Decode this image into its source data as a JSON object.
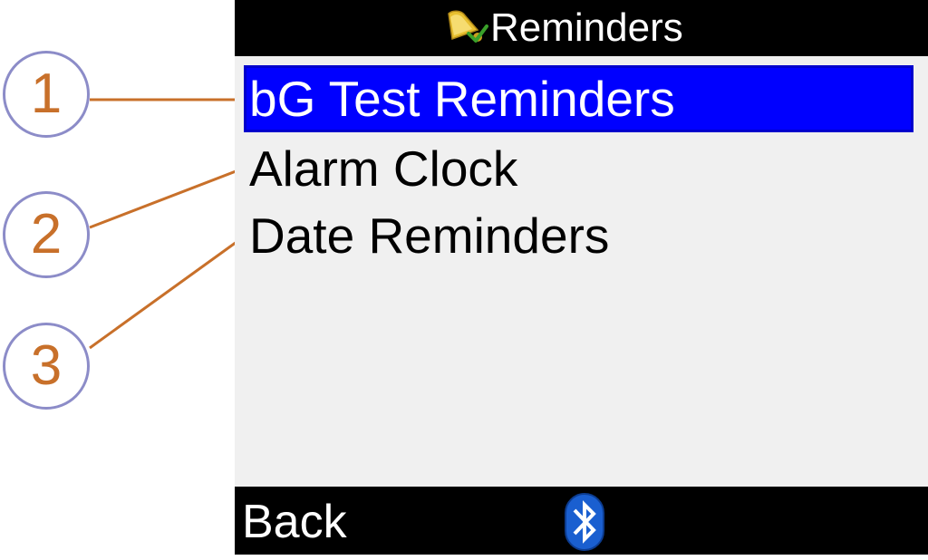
{
  "screen": {
    "title": "Reminders",
    "title_icon": "bell-icon",
    "menu": [
      {
        "label": "bG Test Reminders",
        "selected": true
      },
      {
        "label": "Alarm Clock",
        "selected": false
      },
      {
        "label": "Date Reminders",
        "selected": false
      }
    ],
    "bottom_bar": {
      "back_label": "Back",
      "status_icon": "bluetooth-icon"
    }
  },
  "callouts": [
    "1",
    "2",
    "3"
  ],
  "colors": {
    "selection": "#0000ff",
    "bar_background": "#000000",
    "screen_background": "#f0f0f0",
    "callout_number": "#c8702a",
    "callout_circle": "#8c8cc8"
  }
}
